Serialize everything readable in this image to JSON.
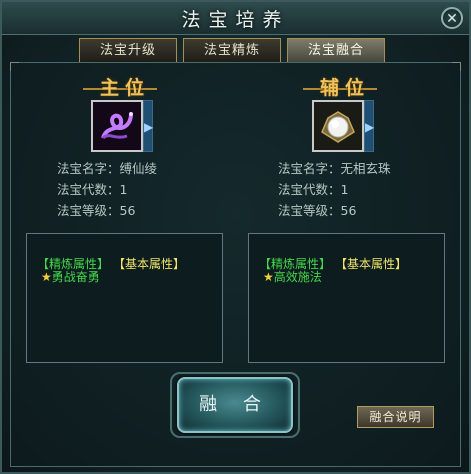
{
  "window": {
    "title": "法宝培养",
    "close_glyph": "✕"
  },
  "tabs": [
    {
      "label": "法宝升级",
      "active": false
    },
    {
      "label": "法宝精炼",
      "active": false
    },
    {
      "label": "法宝融合",
      "active": true
    }
  ],
  "main": {
    "heading": "主位",
    "item_icon": "purple-silk-ribbon-icon",
    "name_label": "法宝名字：",
    "name": "缚仙绫",
    "gen_label": "法宝代数：",
    "gen": "1",
    "level_label": "法宝等级：",
    "level": "56",
    "attr_tab_refine": "【精炼属性】",
    "attr_tab_basic": "【基本属性】",
    "attr_star": "★",
    "attr_value": "勇战奋勇"
  },
  "aux": {
    "heading": "辅位",
    "item_icon": "white-pearl-icon",
    "name_label": "法宝名字：",
    "name": "无相玄珠",
    "gen_label": "法宝代数：",
    "gen": "1",
    "level_label": "法宝等级：",
    "level": "56",
    "attr_tab_refine": "【精炼属性】",
    "attr_tab_basic": "【基本属性】",
    "attr_star": "★",
    "attr_value": "高效施法"
  },
  "buttons": {
    "fuse": "融 合",
    "explain": "融合说明"
  },
  "colors": {
    "accent_gold": "#f1c35a",
    "attr_green": "#45d64a",
    "attr_yellow": "#f1e36a"
  }
}
